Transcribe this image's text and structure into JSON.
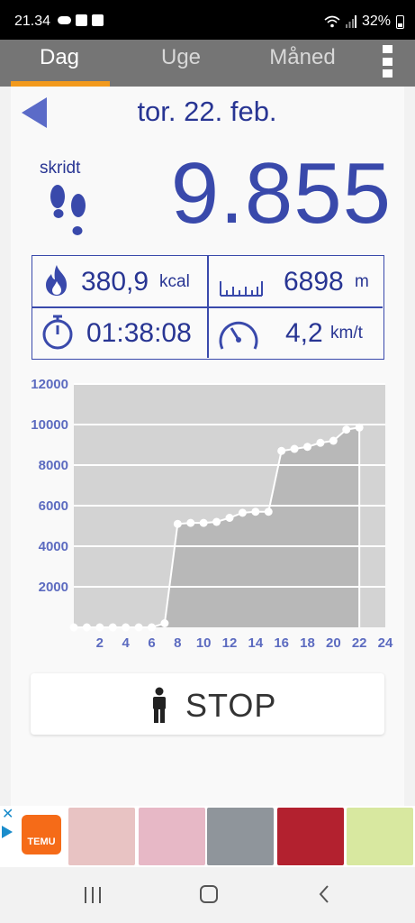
{
  "status_bar": {
    "time": "21.34",
    "battery": "32%"
  },
  "tabs": [
    {
      "label": "Dag",
      "active": true
    },
    {
      "label": "Uge",
      "active": false
    },
    {
      "label": "Måned",
      "active": false
    }
  ],
  "header": {
    "date": "tor. 22. feb."
  },
  "steps": {
    "label": "skridt",
    "value": "9.855"
  },
  "stats": {
    "calories": {
      "value": "380,9",
      "unit": "kcal",
      "icon": "flame-icon"
    },
    "distance": {
      "value": "6898",
      "unit": "m",
      "icon": "ruler-icon"
    },
    "duration": {
      "value": "01:38:08",
      "icon": "stopwatch-icon"
    },
    "speed": {
      "value": "4,2",
      "unit": "km/t",
      "icon": "speedometer-icon"
    }
  },
  "chart_data": {
    "type": "area",
    "title": "",
    "xlabel": "",
    "ylabel": "",
    "xlim": [
      0,
      24
    ],
    "ylim": [
      0,
      12000
    ],
    "x_ticks": [
      2,
      4,
      6,
      8,
      10,
      12,
      14,
      16,
      18,
      20,
      22,
      24
    ],
    "y_ticks": [
      2000,
      4000,
      6000,
      8000,
      10000,
      12000
    ],
    "grid": true,
    "series": [
      {
        "x": [
          0,
          1,
          2,
          3,
          4,
          5,
          6,
          7,
          8,
          9,
          10,
          11,
          12,
          13,
          14,
          15,
          16,
          17,
          18,
          19,
          20,
          21,
          22
        ],
        "values": [
          0,
          0,
          0,
          0,
          0,
          0,
          0,
          200,
          5100,
          5150,
          5150,
          5200,
          5400,
          5650,
          5700,
          5700,
          8700,
          8800,
          8900,
          9100,
          9200,
          9750,
          9855
        ]
      }
    ],
    "colors": {
      "line": "#ffffff",
      "fill": "#b8b8b8",
      "axis_labels": "#5c6bc0"
    }
  },
  "stop_button": {
    "label": "STOP",
    "icon": "person-icon"
  },
  "ad": {
    "brand": "TEMU"
  }
}
